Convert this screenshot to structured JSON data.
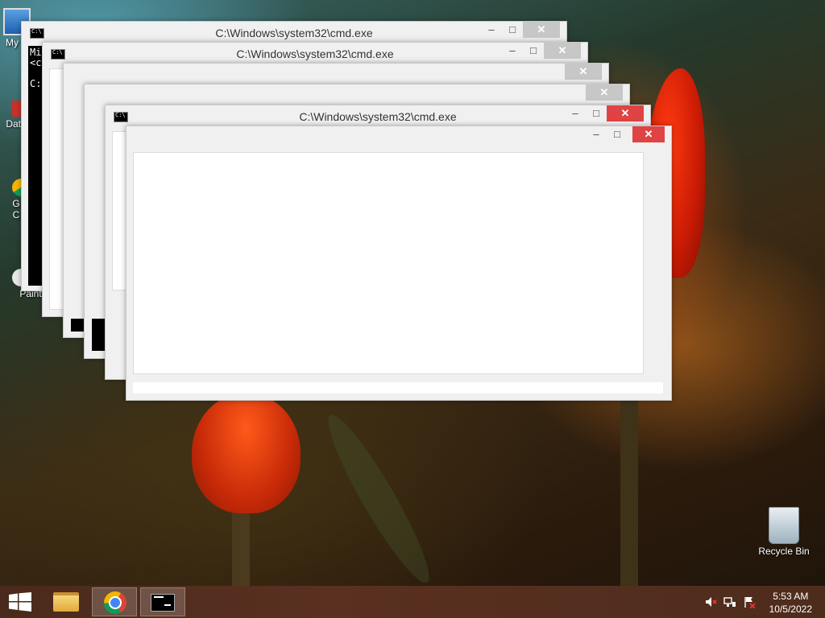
{
  "desktop": {
    "icons": [
      {
        "label": "My Computer",
        "visible_label": "My C"
      },
      {
        "label": "Data",
        "visible_label": "Data"
      },
      {
        "label": "Google Chrome",
        "visible_label": "G\nC"
      },
      {
        "label": "Paint",
        "visible_label": "Paint"
      }
    ],
    "recycle_bin": {
      "label": "Recycle Bin"
    }
  },
  "windows": [
    {
      "title": "C:\\Windows\\system32\\cmd.exe",
      "content_lines": [
        "Mi",
        "<c",
        "",
        "C:"
      ]
    },
    {
      "title": "C:\\Windows\\system32\\cmd.exe"
    },
    {
      "title": "C:\\Windows\\system32\\cmd.exe"
    }
  ],
  "window_buttons": {
    "minimize": "–",
    "maximize": "□",
    "close": "✕"
  },
  "taskbar": {
    "items": [
      {
        "name": "start",
        "icon": "windows-logo-icon"
      },
      {
        "name": "file-explorer",
        "icon": "folder-icon"
      },
      {
        "name": "chrome",
        "icon": "chrome-icon"
      },
      {
        "name": "command-prompt",
        "icon": "cmd-icon"
      }
    ],
    "time": "5:53 AM",
    "date": "10/5/2022"
  },
  "colors": {
    "close_red": "#e04343",
    "taskbar": "#54301e"
  }
}
